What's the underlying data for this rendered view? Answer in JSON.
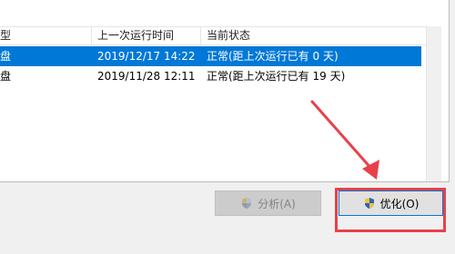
{
  "columns": [
    "型",
    "上一次运行时间",
    "当前状态"
  ],
  "rows": [
    {
      "type": "盘",
      "last_run": "2019/12/17 14:22",
      "status": "正常(距上次运行已有 0 天)",
      "selected": true
    },
    {
      "type": "盘",
      "last_run": "2019/11/28 12:11",
      "status": "正常(距上次运行已有 19 天)",
      "selected": false
    }
  ],
  "buttons": {
    "analyze": {
      "label": "分析(A)",
      "enabled": false
    },
    "optimize": {
      "label": "优化(O)",
      "enabled": true
    }
  },
  "colors": {
    "selection": "#0078d7",
    "annotation": "#e8414a"
  },
  "icons": {
    "analyze": "uac-shield-icon",
    "optimize": "uac-shield-icon"
  }
}
